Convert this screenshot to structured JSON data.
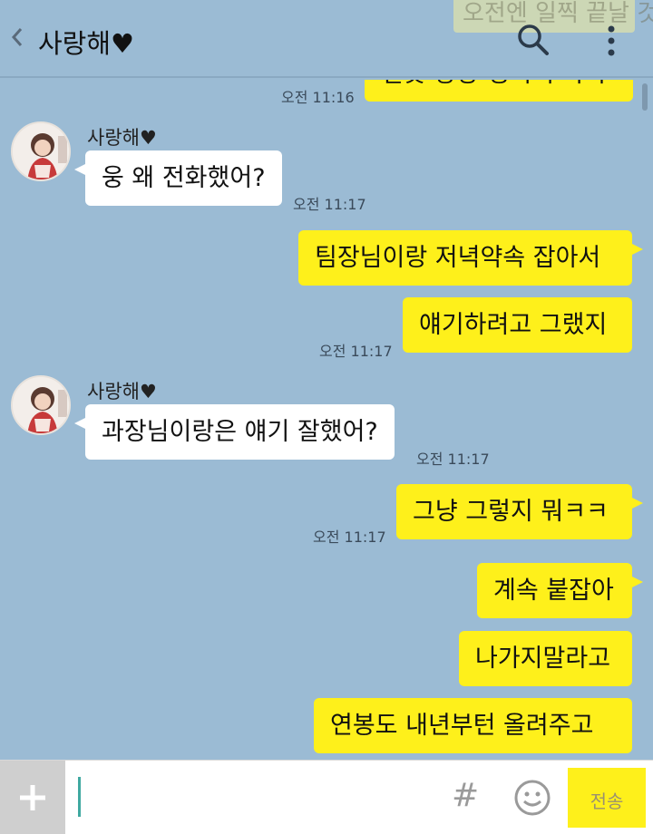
{
  "header": {
    "back_icon": "chevron-left-icon",
    "title": "사랑해♥",
    "search_icon": "search-icon",
    "more_icon": "more-vertical-icon"
  },
  "ghost_top": {
    "text": "오전엔 일찍 끝날 것 같아"
  },
  "messages": [
    {
      "from": "me",
      "text": "겉옷 항상 챙겨서 나가",
      "time": "오전 11:16"
    },
    {
      "from": "other",
      "sender": "사랑해♥",
      "text": "웅 왜 전화했어?",
      "time": "오전 11:17"
    },
    {
      "from": "me",
      "text": "팀장님이랑 저녁약속 잡아서",
      "time": ""
    },
    {
      "from": "me",
      "text": "얘기하려고 그랬지",
      "time": "오전 11:17"
    },
    {
      "from": "other",
      "sender": "사랑해♥",
      "text": "과장님이랑은 얘기 잘했어?",
      "time": "오전 11:17"
    },
    {
      "from": "me",
      "text": "그냥 그렇지 뭐ㅋㅋ",
      "time": "오전 11:17"
    },
    {
      "from": "me",
      "text": "계속 붙잡아",
      "time": ""
    },
    {
      "from": "me",
      "text": "나가지말라고",
      "time": ""
    },
    {
      "from": "me",
      "text": "연봉도 내년부턴 올려주고",
      "time": ""
    }
  ],
  "input": {
    "plus_icon": "plus-icon",
    "value": "",
    "hash_icon": "#",
    "emoji_icon": "smiley-icon",
    "send_label": "전송"
  },
  "colors": {
    "background": "#9bbbd4",
    "my_bubble": "#fef01b",
    "other_bubble": "#ffffff",
    "send_button": "#fef01b"
  }
}
